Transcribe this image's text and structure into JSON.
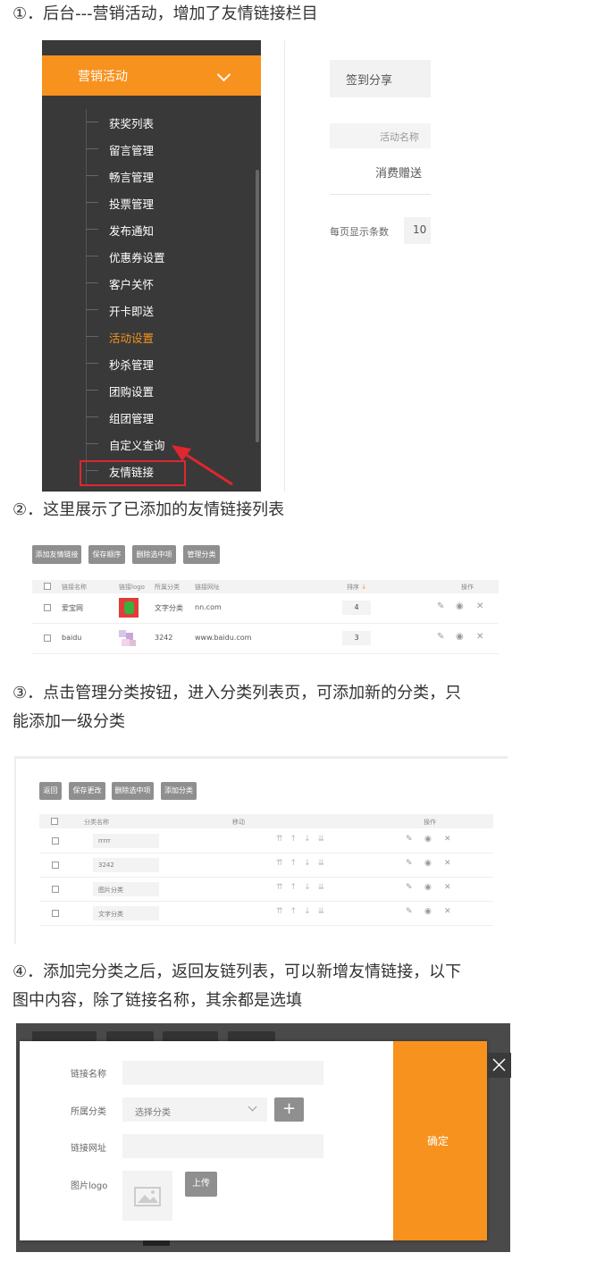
{
  "steps": {
    "s1": "①．后台---营销活动，增加了友情链接栏目",
    "s2": "②．这里展示了已添加的友情链接列表",
    "s3_l1": "③．点击管理分类按钮，进入分类列表页，可添加新的分类，只",
    "s3_l2": "能添加一级分类",
    "s4_l1": "④．添加完分类之后，返回友链列表，可以新增友情链接，以下",
    "s4_l2": "图中内容，除了链接名称，其余都是选填"
  },
  "sidebar": {
    "header": "营销活动",
    "items": [
      "获奖列表",
      "留言管理",
      "畅言管理",
      "投票管理",
      "发布通知",
      "优惠券设置",
      "客户关怀",
      "开卡即送",
      "活动设置",
      "秒杀管理",
      "团购设置",
      "组团管理",
      "自定义查询",
      "友情链接"
    ],
    "active_item": "活动设置"
  },
  "right_panel": {
    "tab": "签到分享",
    "tab_more": "?",
    "input_placeholder": "活动名称",
    "row_text": "消费赠送",
    "per_page_label": "每页显示条数",
    "per_page_value": "10"
  },
  "links_list": {
    "buttons": [
      "添加友情链接",
      "保存顺序",
      "删除选中项",
      "管理分类"
    ],
    "columns": [
      "链接名称",
      "链接logo",
      "所属分类",
      "链接网址",
      "排序",
      "操作"
    ],
    "rows": [
      {
        "name": "爱宝网",
        "category": "文字分类",
        "url": "nn.com",
        "sort": "4"
      },
      {
        "name": "baidu",
        "category": "3242",
        "url": "www.baidu.com",
        "sort": "3"
      }
    ]
  },
  "category_list": {
    "buttons": [
      "返回",
      "保存更改",
      "删除选中项",
      "添加分类"
    ],
    "columns": [
      "分类名称",
      "移动",
      "操作"
    ],
    "rows": [
      "rrrrr",
      "3242",
      "图片分类",
      "文字分类"
    ]
  },
  "add_dialog": {
    "fields": {
      "name_label": "链接名称",
      "category_label": "所属分类",
      "category_placeholder": "选择分类",
      "url_label": "链接网址",
      "logo_label": "图片logo"
    },
    "add_btn": "+",
    "upload_btn": "上传",
    "confirm_btn": "确定"
  },
  "colors": {
    "accent": "#f7921e",
    "sidebar_bg": "#393939",
    "highlight": "#e0262e"
  },
  "icons": [
    "chevron-down-icon",
    "edit-icon",
    "eye-icon",
    "close-icon",
    "up-arrow-icon",
    "down-arrow-icon",
    "image-icon",
    "plus-icon"
  ]
}
